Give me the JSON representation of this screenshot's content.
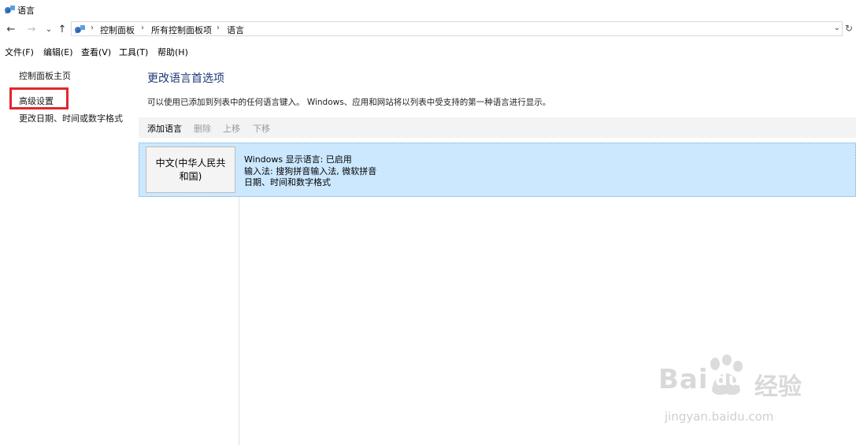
{
  "window": {
    "title": "语言",
    "app_icon": "control-panel-icon"
  },
  "nav": {
    "back_icon": "←",
    "forward_icon": "→",
    "history_icon": "⌄",
    "up_icon": "↑",
    "refresh_icon": "↻"
  },
  "address_bar": {
    "icon": "control-panel-icon",
    "separator": "›",
    "crumbs": [
      "控制面板",
      "所有控制面板项",
      "语言"
    ],
    "dropdown_icon": "⌄"
  },
  "menubar": [
    "文件(F)",
    "编辑(E)",
    "查看(V)",
    "工具(T)",
    "帮助(H)"
  ],
  "sidebar": {
    "links": [
      "控制面板主页",
      "高级设置",
      "更改日期、时间或数字格式"
    ],
    "highlight_color": "#e0282e"
  },
  "main": {
    "heading": "更改语言首选项",
    "description": "可以使用已添加到列表中的任何语言键入。 Windows、应用和网站将以列表中受支持的第一种语言进行显示。",
    "toolbar": {
      "add": "添加语言",
      "remove": "删除",
      "move_up": "上移",
      "move_down": "下移"
    },
    "languages": [
      {
        "name": "中文(中华人民共和国)",
        "details": [
          "Windows 显示语言: 已启用",
          "输入法: 搜狗拼音输入法, 微软拼音",
          "日期、时间和数字格式"
        ]
      }
    ],
    "selection_color": "#cce8ff"
  },
  "watermark": {
    "brand_left": "Bai",
    "brand_mid": "du",
    "brand_right": "经验",
    "url": "jingyan.baidu.com"
  }
}
